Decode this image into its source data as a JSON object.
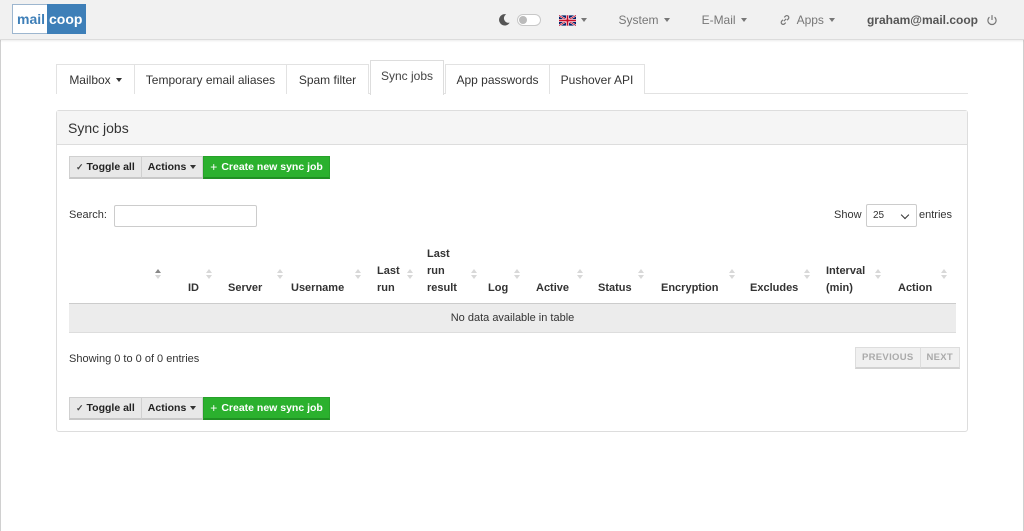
{
  "navbar": {
    "logo_left": "mail",
    "logo_right": "coop",
    "system_label": "System",
    "email_label": "E-Mail",
    "apps_label": "Apps",
    "user_label": "graham@mail.coop"
  },
  "tabs": [
    {
      "label": "Mailbox",
      "has_caret": true
    },
    {
      "label": "Temporary email aliases"
    },
    {
      "label": "Spam filter"
    },
    {
      "label": "Sync jobs",
      "active": true
    },
    {
      "label": "App passwords"
    },
    {
      "label": "Pushover API"
    }
  ],
  "panel": {
    "title": "Sync jobs",
    "toggle_all": "Toggle all",
    "actions": "Actions",
    "create": "Create new sync job",
    "search_label": "Search:",
    "show_label": "Show",
    "page_size": "25",
    "entries_label": "entries",
    "empty_message": "No data available in table",
    "info": "Showing 0 to 0 of 0 entries",
    "previous": "PREVIOUS",
    "next": "NEXT"
  },
  "table": {
    "columns": [
      {
        "label": ""
      },
      {
        "label": "ID"
      },
      {
        "label": "Server"
      },
      {
        "label": "Username"
      },
      {
        "label": "Last run"
      },
      {
        "label": "Last run result"
      },
      {
        "label": "Log"
      },
      {
        "label": "Active"
      },
      {
        "label": "Status"
      },
      {
        "label": "Encryption"
      },
      {
        "label": "Excludes"
      },
      {
        "label": "Interval (min)"
      },
      {
        "label": "Action"
      }
    ]
  },
  "colors": {
    "success": "#2bb12e",
    "brand": "#3e7fb8",
    "navbar_bg": "#f1f1f1"
  }
}
